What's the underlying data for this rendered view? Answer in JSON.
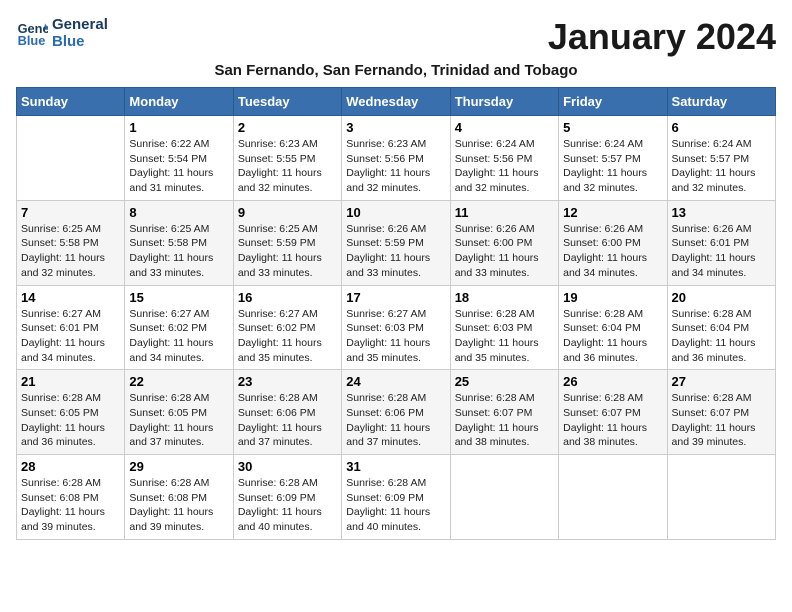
{
  "logo": {
    "line1": "General",
    "line2": "Blue"
  },
  "title": "January 2024",
  "subtitle": "San Fernando, San Fernando, Trinidad and Tobago",
  "days_of_week": [
    "Sunday",
    "Monday",
    "Tuesday",
    "Wednesday",
    "Thursday",
    "Friday",
    "Saturday"
  ],
  "weeks": [
    [
      {
        "num": "",
        "sunrise": "",
        "sunset": "",
        "daylight": ""
      },
      {
        "num": "1",
        "sunrise": "Sunrise: 6:22 AM",
        "sunset": "Sunset: 5:54 PM",
        "daylight": "Daylight: 11 hours and 31 minutes."
      },
      {
        "num": "2",
        "sunrise": "Sunrise: 6:23 AM",
        "sunset": "Sunset: 5:55 PM",
        "daylight": "Daylight: 11 hours and 32 minutes."
      },
      {
        "num": "3",
        "sunrise": "Sunrise: 6:23 AM",
        "sunset": "Sunset: 5:56 PM",
        "daylight": "Daylight: 11 hours and 32 minutes."
      },
      {
        "num": "4",
        "sunrise": "Sunrise: 6:24 AM",
        "sunset": "Sunset: 5:56 PM",
        "daylight": "Daylight: 11 hours and 32 minutes."
      },
      {
        "num": "5",
        "sunrise": "Sunrise: 6:24 AM",
        "sunset": "Sunset: 5:57 PM",
        "daylight": "Daylight: 11 hours and 32 minutes."
      },
      {
        "num": "6",
        "sunrise": "Sunrise: 6:24 AM",
        "sunset": "Sunset: 5:57 PM",
        "daylight": "Daylight: 11 hours and 32 minutes."
      }
    ],
    [
      {
        "num": "7",
        "sunrise": "Sunrise: 6:25 AM",
        "sunset": "Sunset: 5:58 PM",
        "daylight": "Daylight: 11 hours and 32 minutes."
      },
      {
        "num": "8",
        "sunrise": "Sunrise: 6:25 AM",
        "sunset": "Sunset: 5:58 PM",
        "daylight": "Daylight: 11 hours and 33 minutes."
      },
      {
        "num": "9",
        "sunrise": "Sunrise: 6:25 AM",
        "sunset": "Sunset: 5:59 PM",
        "daylight": "Daylight: 11 hours and 33 minutes."
      },
      {
        "num": "10",
        "sunrise": "Sunrise: 6:26 AM",
        "sunset": "Sunset: 5:59 PM",
        "daylight": "Daylight: 11 hours and 33 minutes."
      },
      {
        "num": "11",
        "sunrise": "Sunrise: 6:26 AM",
        "sunset": "Sunset: 6:00 PM",
        "daylight": "Daylight: 11 hours and 33 minutes."
      },
      {
        "num": "12",
        "sunrise": "Sunrise: 6:26 AM",
        "sunset": "Sunset: 6:00 PM",
        "daylight": "Daylight: 11 hours and 34 minutes."
      },
      {
        "num": "13",
        "sunrise": "Sunrise: 6:26 AM",
        "sunset": "Sunset: 6:01 PM",
        "daylight": "Daylight: 11 hours and 34 minutes."
      }
    ],
    [
      {
        "num": "14",
        "sunrise": "Sunrise: 6:27 AM",
        "sunset": "Sunset: 6:01 PM",
        "daylight": "Daylight: 11 hours and 34 minutes."
      },
      {
        "num": "15",
        "sunrise": "Sunrise: 6:27 AM",
        "sunset": "Sunset: 6:02 PM",
        "daylight": "Daylight: 11 hours and 34 minutes."
      },
      {
        "num": "16",
        "sunrise": "Sunrise: 6:27 AM",
        "sunset": "Sunset: 6:02 PM",
        "daylight": "Daylight: 11 hours and 35 minutes."
      },
      {
        "num": "17",
        "sunrise": "Sunrise: 6:27 AM",
        "sunset": "Sunset: 6:03 PM",
        "daylight": "Daylight: 11 hours and 35 minutes."
      },
      {
        "num": "18",
        "sunrise": "Sunrise: 6:28 AM",
        "sunset": "Sunset: 6:03 PM",
        "daylight": "Daylight: 11 hours and 35 minutes."
      },
      {
        "num": "19",
        "sunrise": "Sunrise: 6:28 AM",
        "sunset": "Sunset: 6:04 PM",
        "daylight": "Daylight: 11 hours and 36 minutes."
      },
      {
        "num": "20",
        "sunrise": "Sunrise: 6:28 AM",
        "sunset": "Sunset: 6:04 PM",
        "daylight": "Daylight: 11 hours and 36 minutes."
      }
    ],
    [
      {
        "num": "21",
        "sunrise": "Sunrise: 6:28 AM",
        "sunset": "Sunset: 6:05 PM",
        "daylight": "Daylight: 11 hours and 36 minutes."
      },
      {
        "num": "22",
        "sunrise": "Sunrise: 6:28 AM",
        "sunset": "Sunset: 6:05 PM",
        "daylight": "Daylight: 11 hours and 37 minutes."
      },
      {
        "num": "23",
        "sunrise": "Sunrise: 6:28 AM",
        "sunset": "Sunset: 6:06 PM",
        "daylight": "Daylight: 11 hours and 37 minutes."
      },
      {
        "num": "24",
        "sunrise": "Sunrise: 6:28 AM",
        "sunset": "Sunset: 6:06 PM",
        "daylight": "Daylight: 11 hours and 37 minutes."
      },
      {
        "num": "25",
        "sunrise": "Sunrise: 6:28 AM",
        "sunset": "Sunset: 6:07 PM",
        "daylight": "Daylight: 11 hours and 38 minutes."
      },
      {
        "num": "26",
        "sunrise": "Sunrise: 6:28 AM",
        "sunset": "Sunset: 6:07 PM",
        "daylight": "Daylight: 11 hours and 38 minutes."
      },
      {
        "num": "27",
        "sunrise": "Sunrise: 6:28 AM",
        "sunset": "Sunset: 6:07 PM",
        "daylight": "Daylight: 11 hours and 39 minutes."
      }
    ],
    [
      {
        "num": "28",
        "sunrise": "Sunrise: 6:28 AM",
        "sunset": "Sunset: 6:08 PM",
        "daylight": "Daylight: 11 hours and 39 minutes."
      },
      {
        "num": "29",
        "sunrise": "Sunrise: 6:28 AM",
        "sunset": "Sunset: 6:08 PM",
        "daylight": "Daylight: 11 hours and 39 minutes."
      },
      {
        "num": "30",
        "sunrise": "Sunrise: 6:28 AM",
        "sunset": "Sunset: 6:09 PM",
        "daylight": "Daylight: 11 hours and 40 minutes."
      },
      {
        "num": "31",
        "sunrise": "Sunrise: 6:28 AM",
        "sunset": "Sunset: 6:09 PM",
        "daylight": "Daylight: 11 hours and 40 minutes."
      },
      {
        "num": "",
        "sunrise": "",
        "sunset": "",
        "daylight": ""
      },
      {
        "num": "",
        "sunrise": "",
        "sunset": "",
        "daylight": ""
      },
      {
        "num": "",
        "sunrise": "",
        "sunset": "",
        "daylight": ""
      }
    ]
  ]
}
